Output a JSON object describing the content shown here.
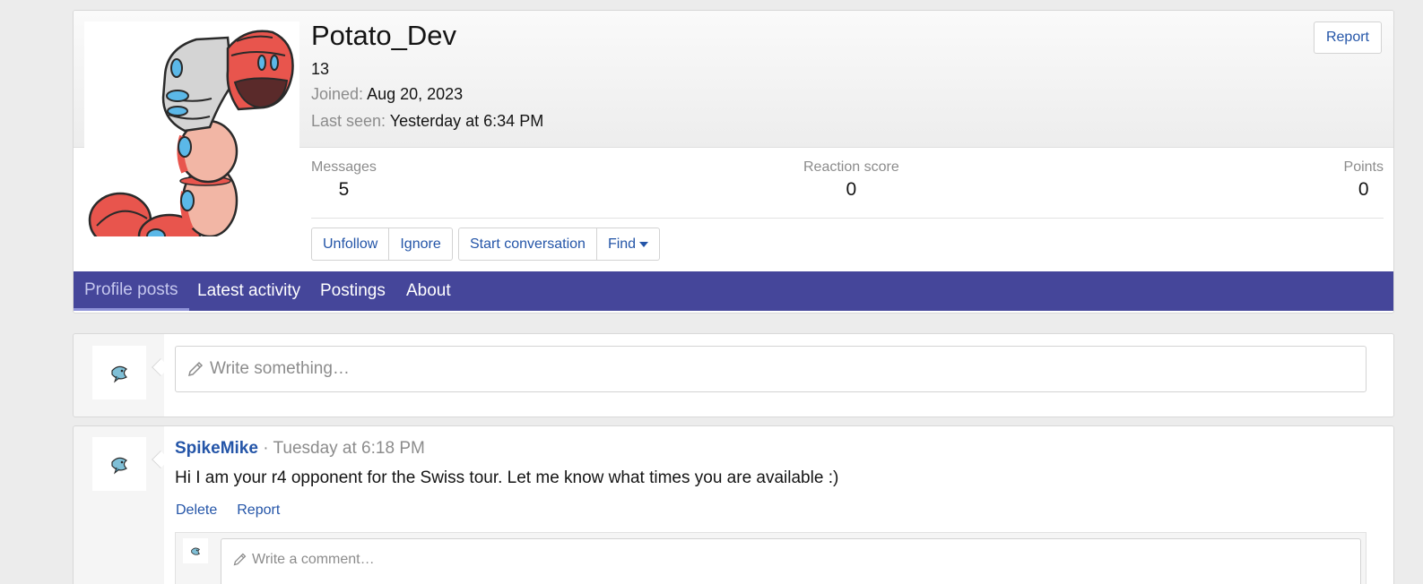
{
  "profile": {
    "username": "Potato_Dev",
    "user_title": "13",
    "joined_label": "Joined:",
    "joined_value": "Aug 20, 2023",
    "last_seen_label": "Last seen:",
    "last_seen_value": "Yesterday at 6:34 PM",
    "report_label": "Report",
    "avatar_icon": "red-worm-creature-avatar"
  },
  "stats": [
    {
      "label": "Messages",
      "value": "5"
    },
    {
      "label": "Reaction score",
      "value": "0"
    },
    {
      "label": "Points",
      "value": "0"
    }
  ],
  "actions": {
    "unfollow": "Unfollow",
    "ignore": "Ignore",
    "start_conversation": "Start conversation",
    "find": "Find"
  },
  "tabs": [
    {
      "label": "Profile posts",
      "active": true
    },
    {
      "label": "Latest activity",
      "active": false
    },
    {
      "label": "Postings",
      "active": false
    },
    {
      "label": "About",
      "active": false
    }
  ],
  "composer": {
    "placeholder": "Write something…"
  },
  "posts": [
    {
      "author": "SpikeMike",
      "separator": "·",
      "time": "Tuesday at 6:18 PM",
      "text": "Hi I am your r4 opponent for the Swiss tour. Let me know what times you are available :)",
      "delete_label": "Delete",
      "report_label": "Report",
      "comment_placeholder": "Write a comment…"
    }
  ],
  "colors": {
    "link": "#2455a8",
    "tab_bar": "#45469a",
    "tab_active": "#c5c7ee",
    "page_bg": "#ececec"
  }
}
